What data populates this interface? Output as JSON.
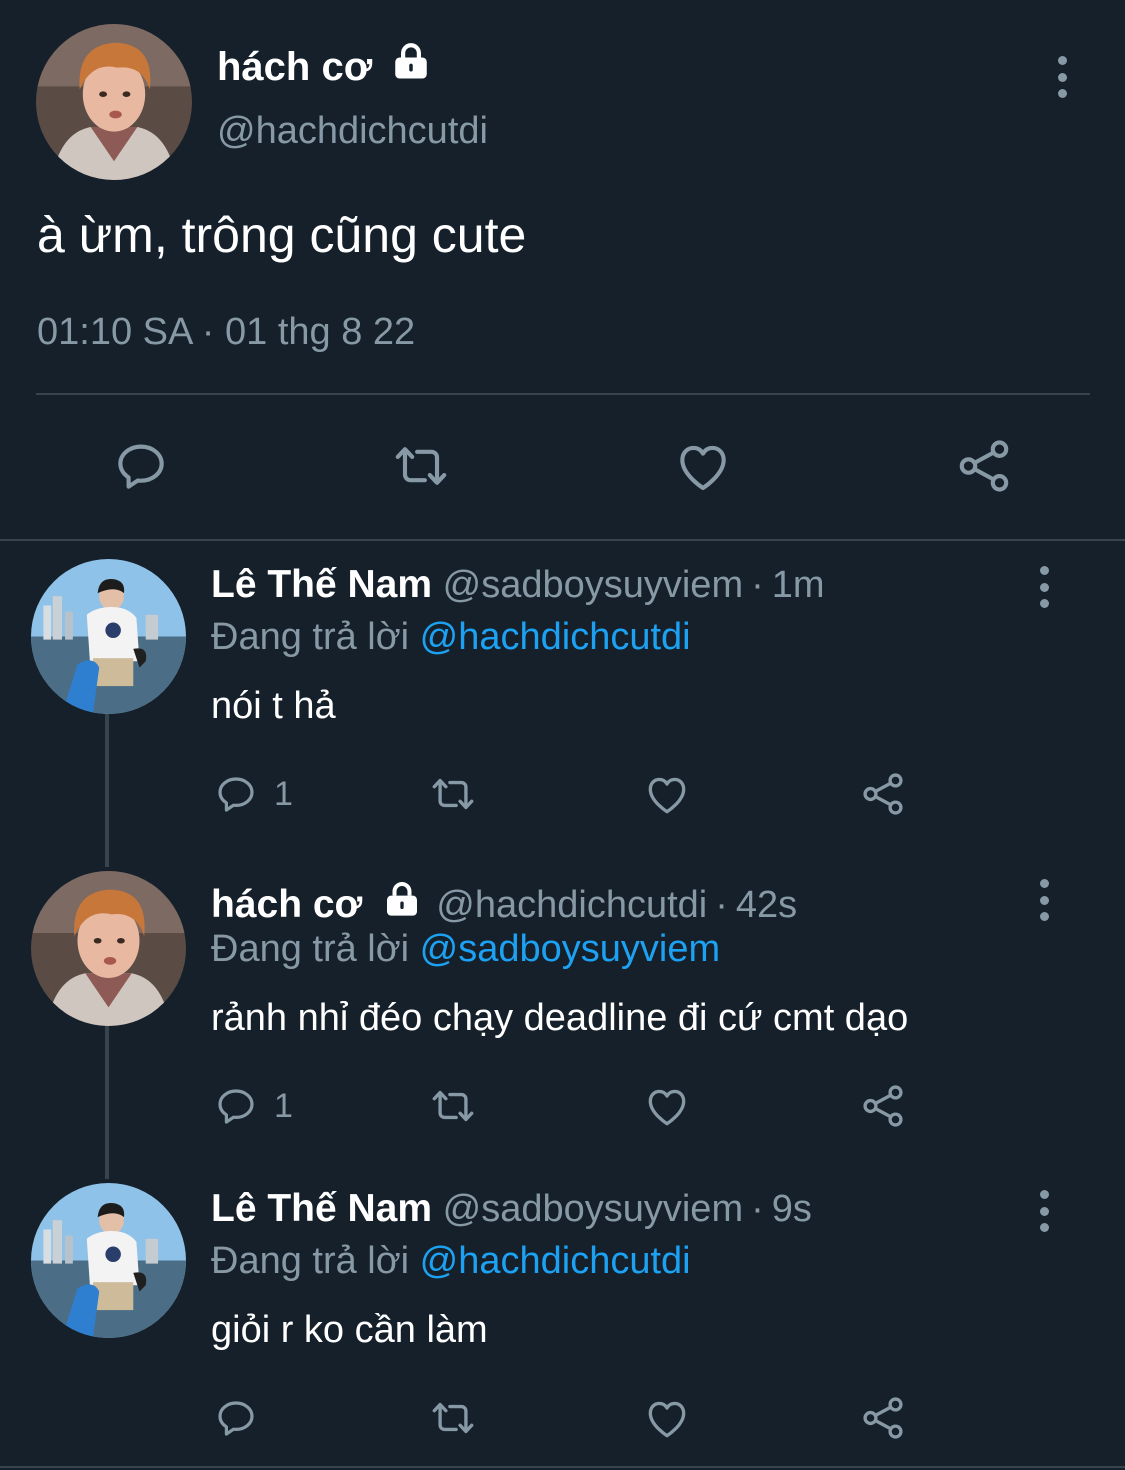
{
  "main_tweet": {
    "author_name": "hách cơ",
    "author_handle": "@hachdichcutdi",
    "text": "à ừm, trông cũng cute",
    "timestamp": "01:10 SA · 01 thg 8 22",
    "locked": true
  },
  "replies": [
    {
      "author_name": "Lê Thế Nam",
      "author_handle": "@sadboysuyviem",
      "age": "1m",
      "replying_label": "Đang trả lời",
      "replying_to": "@hachdichcutdi",
      "text": "nói t hả",
      "reply_count": "1",
      "avatar": "boy-by-sea"
    },
    {
      "author_name": "hách cơ",
      "author_handle": "@hachdichcutdi",
      "age": "42s",
      "replying_label": "Đang trả lời",
      "replying_to": "@sadboysuyviem",
      "text": "rảnh nhỉ đéo chạy deadline đi cứ cmt dạo",
      "reply_count": "1",
      "locked": true,
      "avatar": "orange-hair"
    },
    {
      "author_name": "Lê Thế Nam",
      "author_handle": "@sadboysuyviem",
      "age": "9s",
      "replying_label": "Đang trả lời",
      "replying_to": "@hachdichcutdi",
      "text": "giỏi r ko cần làm",
      "reply_count": "",
      "avatar": "boy-by-sea"
    }
  ],
  "icons": {
    "reply": "reply-icon",
    "retweet": "retweet-icon",
    "like": "heart-icon",
    "share": "share-icon",
    "more": "more-icon",
    "lock": "lock-icon"
  },
  "colors": {
    "background": "#15202b",
    "secondary_text": "#8899a6",
    "mention": "#1da1f2",
    "divider": "#38444d"
  }
}
